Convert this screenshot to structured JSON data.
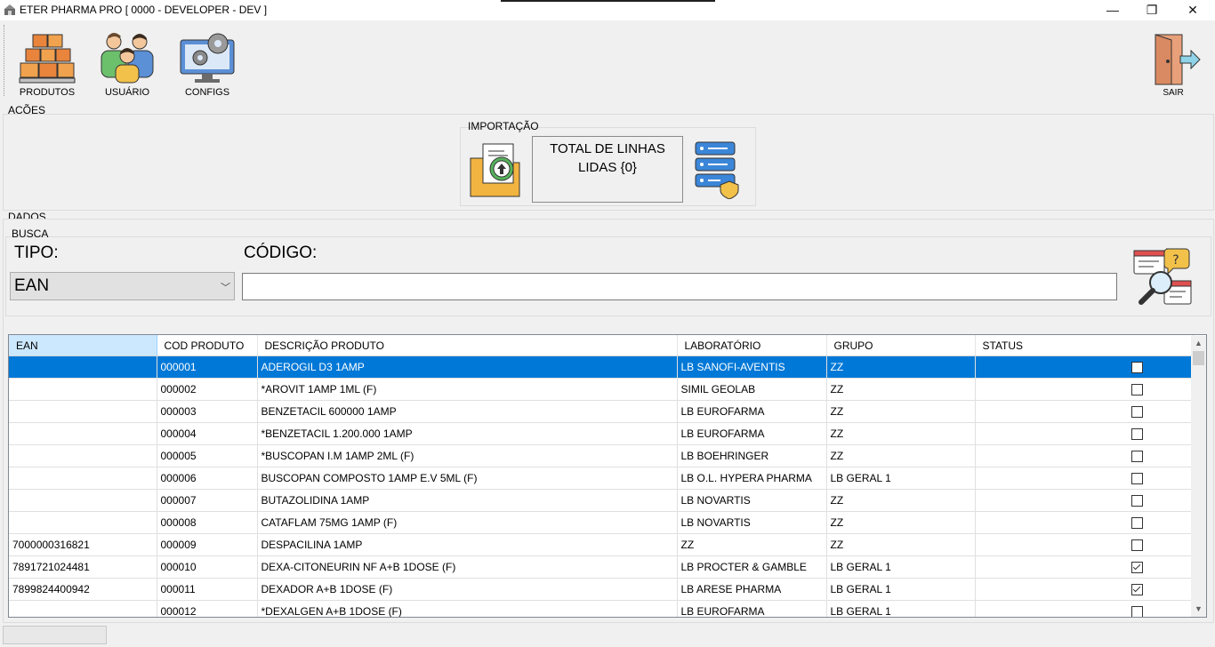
{
  "window": {
    "title": "ETER PHARMA PRO [ 0000 - DEVELOPER - DEV ]",
    "controls": {
      "minimize": "—",
      "restore": "❐",
      "close": "✕"
    }
  },
  "toolbar": {
    "items": [
      {
        "label": "PRODUTOS",
        "icon": "boxes-icon"
      },
      {
        "label": "USUÁRIO",
        "icon": "users-icon"
      },
      {
        "label": "CONFIGS",
        "icon": "monitor-gears-icon"
      }
    ],
    "exit": {
      "label": "SAIR",
      "icon": "exit-door-icon"
    }
  },
  "acoes": {
    "label": "AÇÕES",
    "importacao": {
      "label": "IMPORTAÇÃO",
      "total_line1": "TOTAL DE LINHAS",
      "total_line2": "LIDAS {0}"
    }
  },
  "dados": {
    "label": "DADOS",
    "busca": {
      "label": "BUSCA",
      "tipo_label": "TIPO:",
      "tipo_value": "EAN",
      "codigo_label": "CÓDIGO:",
      "codigo_value": ""
    }
  },
  "grid": {
    "columns": [
      "EAN",
      "COD PRODUTO",
      "DESCRIÇÃO PRODUTO",
      "LABORATÓRIO",
      "GRUPO",
      "STATUS"
    ],
    "rows": [
      {
        "ean": "",
        "cod": "000001",
        "desc": "ADEROGIL D3 1AMP",
        "lab": "LB SANOFI-AVENTIS",
        "grupo": "ZZ",
        "status": false
      },
      {
        "ean": "",
        "cod": "000002",
        "desc": "*AROVIT 1AMP 1ML (F)",
        "lab": "SIMIL GEOLAB",
        "grupo": "ZZ",
        "status": false
      },
      {
        "ean": "",
        "cod": "000003",
        "desc": "BENZETACIL  600000 1AMP",
        "lab": "LB EUROFARMA",
        "grupo": "ZZ",
        "status": false
      },
      {
        "ean": "",
        "cod": "000004",
        "desc": "*BENZETACIL 1.200.000 1AMP",
        "lab": "LB EUROFARMA",
        "grupo": "ZZ",
        "status": false
      },
      {
        "ean": "",
        "cod": "000005",
        "desc": "*BUSCOPAN I.M 1AMP 2ML (F)",
        "lab": "LB BOEHRINGER",
        "grupo": "ZZ",
        "status": false
      },
      {
        "ean": "",
        "cod": "000006",
        "desc": "BUSCOPAN COMPOSTO 1AMP E.V 5ML (F)",
        "lab": "LB O.L. HYPERA PHARMA",
        "grupo": "LB GERAL 1",
        "status": false
      },
      {
        "ean": "",
        "cod": "000007",
        "desc": "BUTAZOLIDINA 1AMP",
        "lab": "LB NOVARTIS",
        "grupo": "ZZ",
        "status": false
      },
      {
        "ean": "",
        "cod": "000008",
        "desc": "CATAFLAM 75MG 1AMP (F)",
        "lab": "LB NOVARTIS",
        "grupo": "ZZ",
        "status": false
      },
      {
        "ean": "7000000316821",
        "cod": "000009",
        "desc": "DESPACILINA 1AMP",
        "lab": "ZZ",
        "grupo": "ZZ",
        "status": false
      },
      {
        "ean": "7891721024481",
        "cod": "000010",
        "desc": "DEXA-CITONEURIN NF A+B 1DOSE (F)",
        "lab": "LB PROCTER & GAMBLE",
        "grupo": "LB GERAL 1",
        "status": true
      },
      {
        "ean": "7899824400942",
        "cod": "000011",
        "desc": "DEXADOR A+B 1DOSE (F)",
        "lab": "LB ARESE PHARMA",
        "grupo": "LB GERAL 1",
        "status": true
      },
      {
        "ean": "",
        "cod": "000012",
        "desc": "*DEXALGEN A+B 1DOSE (F)",
        "lab": "LB EUROFARMA",
        "grupo": "LB GERAL 1",
        "status": false
      }
    ],
    "selected_row": 0
  }
}
